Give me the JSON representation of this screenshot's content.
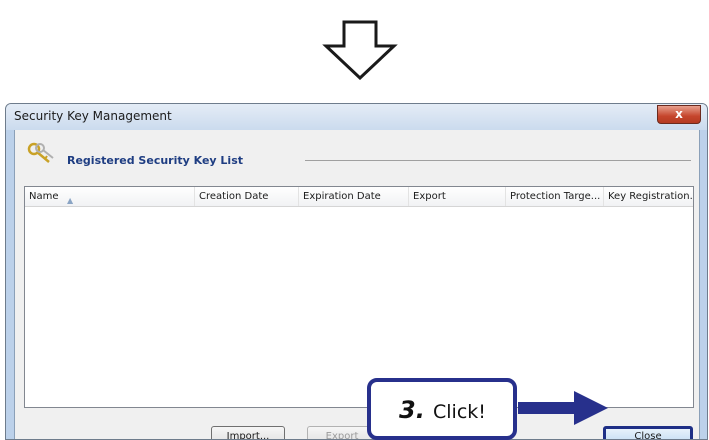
{
  "window": {
    "title": "Security Key Management",
    "close_glyph": "x",
    "section_title": "Registered Security Key List"
  },
  "list": {
    "columns": [
      "Name",
      "Creation Date",
      "Expiration Date",
      "Export",
      "Protection Targe...",
      "Key Registration..."
    ],
    "sort_icon": "sort-ascending-icon",
    "rows": []
  },
  "buttons": {
    "import_label": "Import...",
    "export_label": "Export",
    "close_label": "Close"
  },
  "annotation": {
    "step_number": "3.",
    "instruction": "Click!"
  },
  "colors": {
    "callout_border": "#27308c",
    "section_title": "#1e3d82",
    "close_button_highlight": "#1e2f86"
  }
}
